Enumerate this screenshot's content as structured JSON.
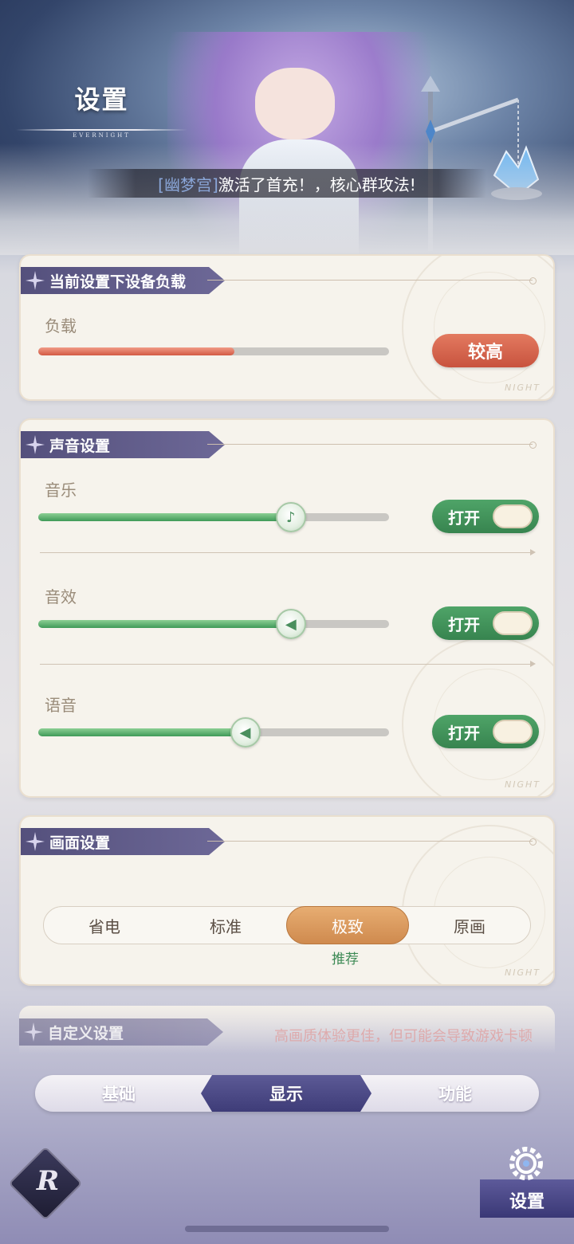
{
  "header": {
    "title": "设置",
    "subtitle": "EVERNIGHT",
    "banner_user": "[幽梦宫]",
    "banner_message": "激活了首充！，核心群攻法!"
  },
  "load_section": {
    "title": "当前设置下设备负载",
    "label": "负载",
    "level": 0.56,
    "badge": "较高",
    "color": "#d25a44"
  },
  "sound_section": {
    "title": "声音设置",
    "items": [
      {
        "label": "音乐",
        "level": 0.72,
        "toggle": "打开",
        "icon": "music-note-icon"
      },
      {
        "label": "音效",
        "level": 0.72,
        "toggle": "打开",
        "icon": "speaker-icon"
      },
      {
        "label": "语音",
        "level": 0.59,
        "toggle": "打开",
        "icon": "speaker-icon"
      }
    ],
    "color": "#3f9a58"
  },
  "display_section": {
    "title": "画面设置",
    "options": [
      "省电",
      "标准",
      "极致",
      "原画"
    ],
    "selected": "极致",
    "recommend": "推荐"
  },
  "custom_section": {
    "title": "自定义设置",
    "hint": "高画质体验更佳，但可能会导致游戏卡顿"
  },
  "tabs": [
    "基础",
    "显示",
    "功能"
  ],
  "active_tab": "显示",
  "corner_button": "设置",
  "card_watermark": "NIGHT"
}
